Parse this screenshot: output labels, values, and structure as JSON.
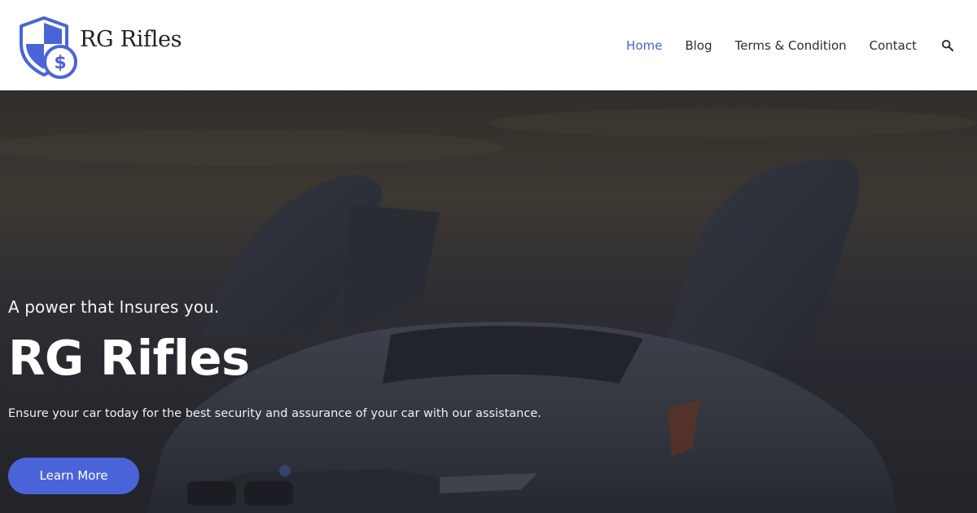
{
  "brand": {
    "name": "RG Rifles",
    "logo_icon": "shield-dollar-icon",
    "logo_color": "#4a64d8"
  },
  "nav": {
    "items": [
      {
        "label": "Home",
        "active": true
      },
      {
        "label": "Blog",
        "active": false
      },
      {
        "label": "Terms & Condition",
        "active": false
      },
      {
        "label": "Contact",
        "active": false
      }
    ],
    "search_icon": "search-icon",
    "active_color": "#4164d8"
  },
  "hero": {
    "tagline": "A power that Insures you.",
    "title": "RG Rifles",
    "description": "Ensure your car today for the best security and assurance of your car with our assistance.",
    "button_label": "Learn More",
    "button_color": "#4a64d8",
    "background": "sports car with open doors at dusk"
  }
}
